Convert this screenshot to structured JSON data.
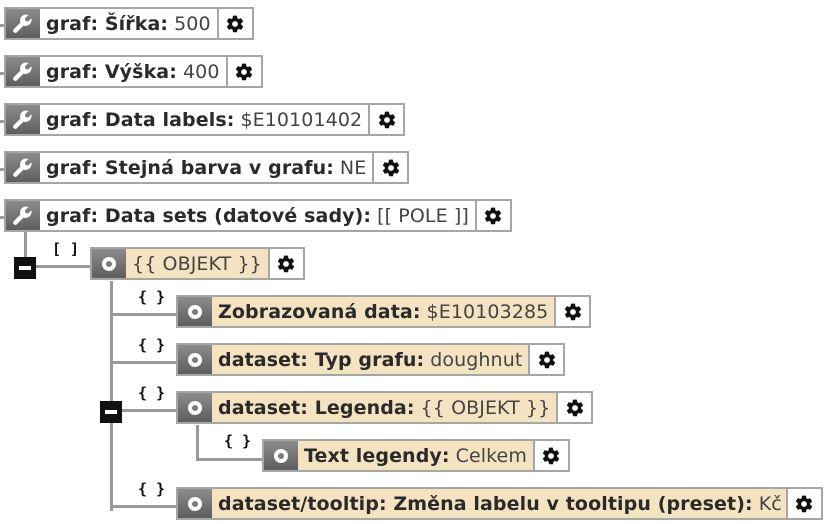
{
  "nodes": [
    {
      "key": "graf: Šířka:",
      "value": "500"
    },
    {
      "key": "graf: Výška:",
      "value": "400"
    },
    {
      "key": "graf: Data labels:",
      "value": "$E10101402"
    },
    {
      "key": "graf: Stejná barva v grafu:",
      "value": "NE"
    },
    {
      "key": "graf: Data sets (datové sady):",
      "value": "[[ POLE ]]"
    }
  ],
  "array_marker": "[ ]",
  "object_marker": "{ }",
  "object_node": {
    "value": "{{ OBJEKT }}"
  },
  "children": [
    {
      "key": "Zobrazovaná data:",
      "value": "$E10103285"
    },
    {
      "key": "dataset: Typ grafu:",
      "value": "doughnut"
    },
    {
      "key": "dataset: Legenda:",
      "value": "{{ OBJEKT }}"
    },
    {
      "key": "Text legendy:",
      "value": "Celkem"
    },
    {
      "key": "dataset/tooltip: Změna labelu v tooltipu (preset):",
      "value": "Kč"
    }
  ]
}
